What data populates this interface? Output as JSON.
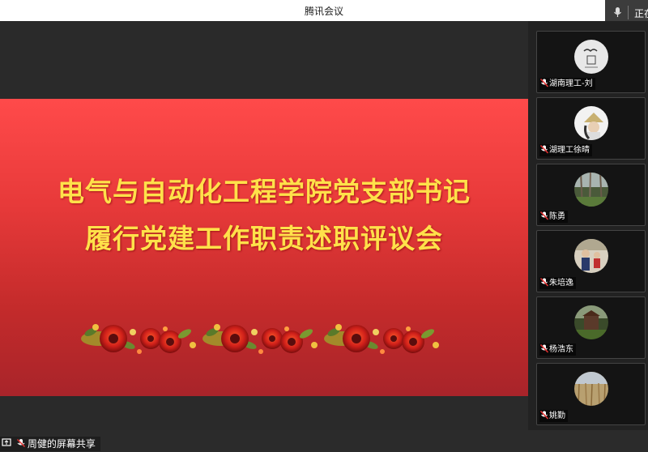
{
  "window": {
    "title": "腾讯会议"
  },
  "speaking": {
    "label": "正在"
  },
  "slide": {
    "line1": "电气与自动化工程学院党支部书记",
    "line2": "履行党建工作职责述职评议会"
  },
  "share": {
    "label": "周健的屏幕共享"
  },
  "participants": [
    {
      "name": "湖南理工-刘"
    },
    {
      "name": "湖理工徐晴"
    },
    {
      "name": "陈勇"
    },
    {
      "name": "朱培逸"
    },
    {
      "name": "杨浩东"
    },
    {
      "name": "姚勤"
    }
  ],
  "colors": {
    "slide_red": "#e83a3a",
    "slide_text": "#ffe14a",
    "muted_mic": "#e03030"
  }
}
